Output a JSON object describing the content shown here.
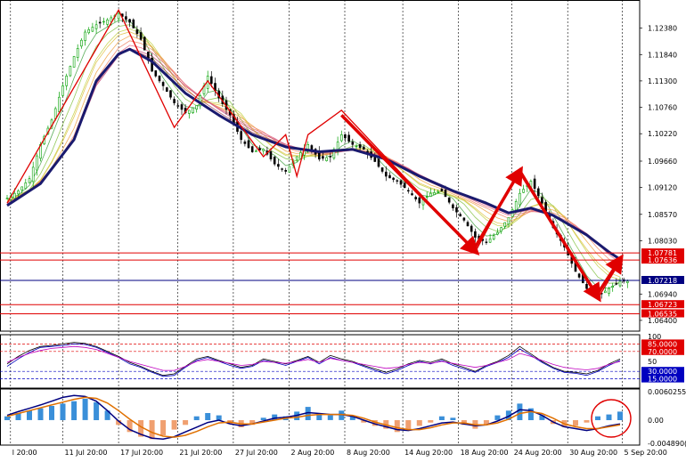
{
  "chart_data": [
    {
      "type": "line",
      "panel": "price",
      "subtype": "candlestick",
      "x_ticks": [
        "l 20:00",
        "11 Jul 20:00",
        "17 Jul 20:00",
        "21 Jul 20:00",
        "27 Jul 20:00",
        "2 Aug 20:00",
        "8 Aug 20:00",
        "14 Aug 20:00",
        "18 Aug 20:00",
        "24 Aug 20:00",
        "30 Aug 20:00",
        "5 Sep 20:00"
      ],
      "y_ticks": [
        1.1238,
        1.1184,
        1.113,
        1.1076,
        1.1022,
        1.0966,
        1.0912,
        1.0857,
        1.0803,
        1.0694,
        1.064
      ],
      "ylim": [
        1.0618,
        1.1292
      ],
      "current_price": 1.07218,
      "price_levels": [
        {
          "value": 1.07781,
          "label": "1.07781",
          "color": "#e00000"
        },
        {
          "value": 1.07636,
          "label": "1.07636",
          "color": "#e00000"
        },
        {
          "value": 1.07218,
          "label": "1.07218",
          "color": "#000080"
        },
        {
          "value": 1.06723,
          "label": "1.06723",
          "color": "#e00000"
        },
        {
          "value": 1.06535,
          "label": "1.06535",
          "color": "#e00000"
        }
      ],
      "close_path": [
        [
          0,
          1.089
        ],
        [
          1,
          1.0905
        ],
        [
          2,
          1.093
        ],
        [
          3,
          1.1
        ],
        [
          4,
          1.105
        ],
        [
          5,
          1.112
        ],
        [
          6,
          1.118
        ],
        [
          7,
          1.123
        ],
        [
          8,
          1.1245
        ],
        [
          9,
          1.1255
        ],
        [
          10,
          1.1268
        ],
        [
          11,
          1.125
        ],
        [
          12,
          1.1215
        ],
        [
          13,
          1.115
        ],
        [
          14,
          1.112
        ],
        [
          15,
          1.1085
        ],
        [
          16,
          1.1065
        ],
        [
          17,
          1.108
        ],
        [
          18,
          1.114
        ],
        [
          19,
          1.1095
        ],
        [
          20,
          1.106
        ],
        [
          21,
          1.101
        ],
        [
          22,
          1.0985
        ],
        [
          23,
          1.099
        ],
        [
          24,
          1.096
        ],
        [
          25,
          1.0945
        ],
        [
          26,
          1.0975
        ],
        [
          27,
          1.1
        ],
        [
          28,
          1.097
        ],
        [
          29,
          1.0975
        ],
        [
          30,
          1.102
        ],
        [
          31,
          1.1
        ],
        [
          32,
          1.099
        ],
        [
          33,
          1.0965
        ],
        [
          34,
          1.0935
        ],
        [
          35,
          1.0925
        ],
        [
          36,
          1.0905
        ],
        [
          37,
          1.088
        ],
        [
          38,
          1.09
        ],
        [
          39,
          1.0905
        ],
        [
          40,
          1.087
        ],
        [
          41,
          1.0845
        ],
        [
          42,
          1.081
        ],
        [
          43,
          1.08
        ],
        [
          44,
          1.082
        ],
        [
          45,
          1.085
        ],
        [
          46,
          1.09
        ],
        [
          47,
          1.0925
        ],
        [
          48,
          1.088
        ],
        [
          49,
          1.083
        ],
        [
          50,
          1.079
        ],
        [
          51,
          1.074
        ],
        [
          52,
          1.0705
        ],
        [
          53,
          1.069
        ],
        [
          54,
          1.0705
        ],
        [
          55,
          1.072
        ]
      ],
      "slow_ma_path": [
        [
          0,
          1.0875
        ],
        [
          3,
          1.092
        ],
        [
          6,
          1.101
        ],
        [
          8,
          1.113
        ],
        [
          10,
          1.1185
        ],
        [
          11,
          1.1195
        ],
        [
          13,
          1.117
        ],
        [
          16,
          1.1105
        ],
        [
          19,
          1.106
        ],
        [
          22,
          1.102
        ],
        [
          25,
          1.0995
        ],
        [
          28,
          1.0985
        ],
        [
          31,
          1.099
        ],
        [
          34,
          1.097
        ],
        [
          37,
          1.0935
        ],
        [
          40,
          1.0905
        ],
        [
          43,
          1.088
        ],
        [
          45,
          1.086
        ],
        [
          47,
          1.087
        ],
        [
          49,
          1.0855
        ],
        [
          52,
          1.0815
        ],
        [
          54,
          1.078
        ],
        [
          55,
          1.0765
        ]
      ],
      "zigzag_path": [
        [
          0,
          1.088
        ],
        [
          10,
          1.1275
        ],
        [
          15,
          1.1035
        ],
        [
          18,
          1.113
        ],
        [
          23,
          1.0975
        ],
        [
          25,
          1.102
        ],
        [
          26,
          1.0935
        ],
        [
          27,
          1.102
        ],
        [
          30,
          1.107
        ],
        [
          42,
          1.078
        ],
        [
          46,
          1.095
        ],
        [
          53,
          1.0685
        ],
        [
          55,
          1.076
        ]
      ],
      "trend_arrows": [
        {
          "from": [
            30,
            1.106
          ],
          "to": [
            42,
            1.0782
          ]
        },
        {
          "from": [
            42,
            1.079
          ],
          "to": [
            46,
            1.0945
          ]
        },
        {
          "from": [
            46,
            1.0945
          ],
          "to": [
            53,
            1.0688
          ]
        },
        {
          "from": [
            53,
            1.0695
          ],
          "to": [
            55,
            1.0765
          ]
        }
      ]
    },
    {
      "type": "line",
      "panel": "oscillator",
      "ylim": [
        0,
        100
      ],
      "levels": [
        {
          "value": 85,
          "label": "85.0000",
          "color": "#e00000"
        },
        {
          "value": 70,
          "label": "70.0000",
          "color": "#e00000"
        },
        {
          "value": 30,
          "label": "30.0000",
          "color": "#0000c0"
        },
        {
          "value": 15,
          "label": "15.0000",
          "color": "#0000c0"
        }
      ],
      "y_ticks": [
        {
          "value": 100,
          "label": "100"
        },
        {
          "value": 50,
          "label": "50"
        }
      ],
      "series": [
        {
          "color": "#000000",
          "values": [
            45,
            60,
            72,
            80,
            82,
            85,
            88,
            86,
            80,
            70,
            60,
            48,
            40,
            30,
            22,
            25,
            40,
            55,
            60,
            52,
            45,
            38,
            42,
            55,
            50,
            45,
            52,
            60,
            48,
            62,
            55,
            50,
            42,
            35,
            28,
            35,
            45,
            52,
            48,
            55,
            45,
            38,
            30,
            42,
            50,
            62,
            80,
            65,
            50,
            38,
            30,
            28,
            25,
            32,
            45,
            55
          ]
        },
        {
          "color": "#0000c0",
          "values": [
            40,
            55,
            68,
            78,
            80,
            82,
            85,
            84,
            78,
            68,
            58,
            45,
            38,
            28,
            20,
            22,
            38,
            52,
            58,
            50,
            42,
            36,
            40,
            52,
            48,
            42,
            50,
            58,
            45,
            58,
            52,
            48,
            40,
            32,
            25,
            32,
            42,
            50,
            45,
            52,
            42,
            35,
            28,
            40,
            48,
            58,
            75,
            62,
            48,
            36,
            28,
            26,
            22,
            30,
            42,
            52
          ]
        },
        {
          "color": "#c000c0",
          "values": [
            48,
            58,
            66,
            72,
            76,
            78,
            80,
            78,
            74,
            66,
            58,
            50,
            44,
            38,
            32,
            32,
            40,
            50,
            54,
            50,
            46,
            42,
            44,
            50,
            48,
            46,
            50,
            54,
            48,
            56,
            52,
            48,
            44,
            40,
            36,
            38,
            44,
            48,
            46,
            50,
            46,
            42,
            38,
            42,
            48,
            54,
            66,
            60,
            52,
            44,
            38,
            35,
            33,
            36,
            44,
            50
          ]
        }
      ]
    },
    {
      "type": "bar",
      "panel": "macd",
      "ylim": [
        -0.0049,
        0.0062
      ],
      "y_ticks": [
        {
          "value": 0.0060255,
          "label": "0.0060255"
        },
        {
          "value": 0.0,
          "label": "0.00"
        },
        {
          "value": -0.0048902,
          "label": "-0.004890("
        }
      ],
      "histogram": [
        0.0008,
        0.0015,
        0.002,
        0.0025,
        0.003,
        0.0035,
        0.004,
        0.0045,
        0.0038,
        0.002,
        -0.001,
        -0.0025,
        -0.0035,
        -0.004,
        -0.0032,
        -0.002,
        -0.001,
        0.0008,
        0.0015,
        0.001,
        -0.0008,
        -0.0015,
        -0.001,
        0.0005,
        0.0012,
        0.0008,
        0.0018,
        0.0028,
        0.0015,
        0.001,
        0.002,
        0.001,
        -0.0005,
        -0.0012,
        -0.0018,
        -0.0025,
        -0.002,
        -0.0012,
        -0.0005,
        0.0008,
        0.0005,
        -0.001,
        -0.0018,
        -0.001,
        0.001,
        0.002,
        0.0035,
        0.0025,
        0.001,
        -0.0008,
        -0.0015,
        -0.0012,
        -0.0005,
        0.0008,
        0.0012,
        0.0018
      ],
      "series": [
        {
          "color": "#000080",
          "values": [
            0.001,
            0.0018,
            0.0025,
            0.0032,
            0.004,
            0.0048,
            0.0052,
            0.005,
            0.004,
            0.002,
            -0.0002,
            -0.002,
            -0.003,
            -0.0038,
            -0.004,
            -0.0035,
            -0.0025,
            -0.0015,
            -0.0005,
            0.0,
            -0.0008,
            -0.0012,
            -0.0008,
            -0.0002,
            0.0004,
            0.0006,
            0.001,
            0.0016,
            0.0014,
            0.0012,
            0.0012,
            0.0008,
            0.0,
            -0.0008,
            -0.0014,
            -0.002,
            -0.0022,
            -0.0018,
            -0.0012,
            -0.0006,
            -0.0004,
            -0.0008,
            -0.0012,
            -0.001,
            -0.0002,
            0.0008,
            0.0022,
            0.002,
            0.001,
            -0.0004,
            -0.0014,
            -0.0018,
            -0.0022,
            -0.0018,
            -0.0012,
            -0.0008
          ]
        },
        {
          "color": "#e07000",
          "values": [
            0.0008,
            0.0014,
            0.002,
            0.0026,
            0.0032,
            0.0038,
            0.0044,
            0.0048,
            0.0046,
            0.0036,
            0.002,
            0.0002,
            -0.0014,
            -0.0026,
            -0.0034,
            -0.0036,
            -0.0032,
            -0.0024,
            -0.0014,
            -0.0006,
            -0.0004,
            -0.0008,
            -0.0008,
            -0.0004,
            0.0,
            0.0004,
            0.0006,
            0.001,
            0.0012,
            0.0012,
            0.0012,
            0.001,
            0.0004,
            -0.0004,
            -0.001,
            -0.0016,
            -0.002,
            -0.002,
            -0.0016,
            -0.001,
            -0.0006,
            -0.0006,
            -0.001,
            -0.001,
            -0.0006,
            0.0002,
            0.0014,
            0.0018,
            0.0014,
            0.0004,
            -0.0008,
            -0.0014,
            -0.0018,
            -0.0018,
            -0.0014,
            -0.001
          ]
        }
      ]
    }
  ],
  "colors": {
    "background": "#ffffff",
    "grid": "#000000",
    "bull_candle": "#00a000",
    "bear_candle": "#000000",
    "zigzag": "#e00000",
    "slow_ma": "#1a1a6e",
    "hist_pos": "#3a8fd9",
    "hist_neg": "#f0a070",
    "highlight_circle": "#e00000"
  }
}
